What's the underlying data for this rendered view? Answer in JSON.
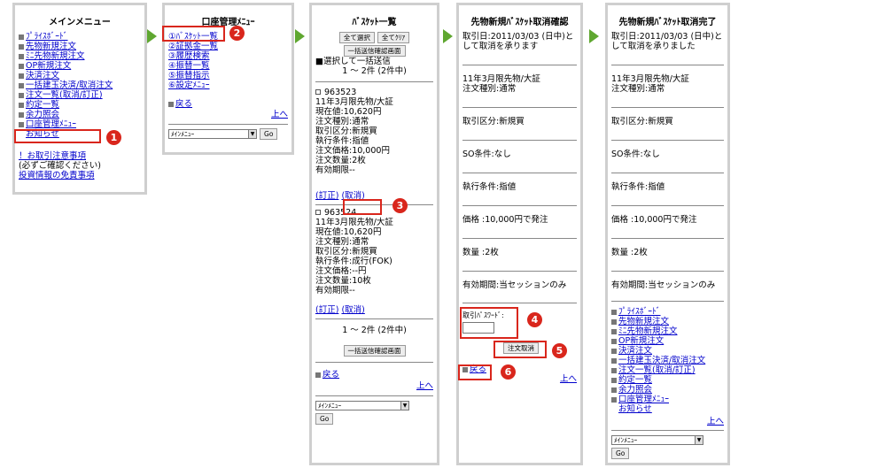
{
  "colors": {
    "arrow": "#5fa730",
    "marker": "#d9261c",
    "link": "#0000cc",
    "frame": "#cfcfcf"
  },
  "arrows": [
    "right-arrow",
    "right-arrow",
    "right-arrow",
    "right-arrow"
  ],
  "screen1": {
    "title": "メインメニュー",
    "menu": [
      "ﾌﾟﾗｲｽﾎﾞｰﾄﾞ",
      "先物新規注文",
      "ﾐﾆ先物新規注文",
      "OP新規注文",
      "決済注文",
      "一括建玉決済/取消注文",
      "注文一覧(取消/訂正)",
      "約定一覧",
      "余力照会",
      "口座管理ﾒﾆｭｰ",
      "お知らせ"
    ],
    "notice_link": "！お取引注意事項",
    "notice_sub": "(必ずご確認ください)",
    "disclaimer_link": "投資情報の免責事項"
  },
  "screen2": {
    "title": "口座管理ﾒﾆｭｰ",
    "menu": [
      "①ﾊﾞｽｹｯﾄ一覧",
      "②証拠金一覧",
      "③履歴検索",
      "④振替一覧",
      "⑤振替指示",
      "⑥設定ﾒﾆｭｰ"
    ],
    "back": "戻る",
    "top": "上へ",
    "select": "ﾒｲﾝﾒﾆｭｰ",
    "go": "Go"
  },
  "screen3": {
    "title": "ﾊﾞｽｹｯﾄ一覧",
    "btn_select_all": "全て選択",
    "btn_clear_all": "全てｸﾘｱ",
    "btn_bulk_confirm": "一括送信確認画面",
    "bulk_note": "■選択して一括送信",
    "count": "1 ～ 2件 (2件中)",
    "orders": [
      {
        "id": "963523",
        "lines": [
          "11年3月限先物/大証",
          "現在値:10,620円",
          "注文種別:通常",
          "取引区分:新規買",
          "執行条件:指値",
          "注文価格:10,000円",
          "注文数量:2枚",
          "有効期限--"
        ],
        "edit": "(訂正)",
        "cancel": "(取消)"
      },
      {
        "id": "963524",
        "lines": [
          "11年3月限先物/大証",
          "現在値:10,620円",
          "注文種別:通常",
          "取引区分:新規買",
          "執行条件:成行(FOK)",
          "注文価格:--円",
          "注文数量:10枚",
          "有効期限--"
        ],
        "edit": "(訂正)",
        "cancel": "(取消)"
      }
    ],
    "count_bottom": "1 ～ 2件 (2件中)",
    "btn_bulk_confirm_bottom": "一括送信確認画面",
    "back": "戻る",
    "top": "上へ",
    "select": "ﾒｲﾝﾒﾆｭｰ",
    "go": "Go"
  },
  "screen4": {
    "title": "先物新規ﾊﾞｽｹｯﾄ取消確認",
    "items": [
      "取引日:2011/03/03 (日中)として取消を承ります",
      "11年3月限先物/大証\n注文種別:通常",
      "取引区分:新規買",
      "SO条件:なし",
      "執行条件:指値",
      "価格 :10,000円で発注",
      "数量 :2枚",
      "有効期間:当セッションのみ"
    ],
    "password_label": "取引ﾊﾟｽﾜｰﾄﾞ:",
    "cancel_btn": "注文取消",
    "back": "戻る",
    "top": "上へ"
  },
  "screen5": {
    "title": "先物新規ﾊﾞｽｹｯﾄ取消完了",
    "items": [
      "取引日:2011/03/03 (日中)として取消を承りました",
      "11年3月限先物/大証\n注文種別:通常",
      "取引区分:新規買",
      "SO条件:なし",
      "執行条件:指値",
      "価格 :10,000円で発注",
      "数量 :2枚",
      "有効期間:当セッションのみ"
    ],
    "menu": [
      "ﾌﾟﾗｲｽﾎﾞｰﾄﾞ",
      "先物新規注文",
      "ﾐﾆ先物新規注文",
      "OP新規注文",
      "決済注文",
      "一括建玉決済/取消注文",
      "注文一覧(取消/訂正)",
      "約定一覧",
      "余力照会",
      "口座管理ﾒﾆｭｰ",
      "お知らせ"
    ],
    "top": "上へ",
    "select": "ﾒｲﾝﾒﾆｭｰ",
    "go": "Go"
  },
  "markers": [
    "1",
    "2",
    "3",
    "4",
    "5",
    "6"
  ]
}
